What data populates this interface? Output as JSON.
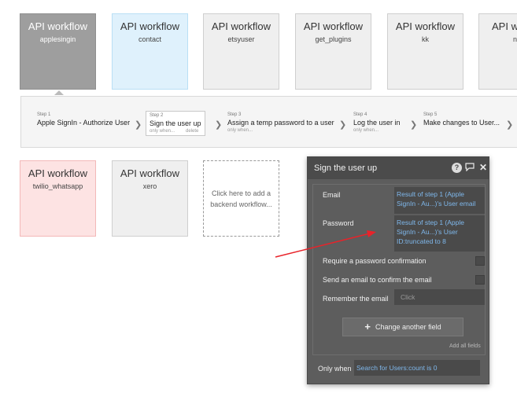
{
  "workflows_row1": [
    {
      "title": "API workflow",
      "subtitle": "applesingin",
      "state": "selected"
    },
    {
      "title": "API workflow",
      "subtitle": "contact",
      "state": "blue"
    },
    {
      "title": "API workflow",
      "subtitle": "etsyuser",
      "state": "default"
    },
    {
      "title": "API workflow",
      "subtitle": "get_plugins",
      "state": "default"
    },
    {
      "title": "API workflow",
      "subtitle": "kk",
      "state": "default"
    },
    {
      "title": "API workflow",
      "subtitle": "newt",
      "state": "default"
    }
  ],
  "workflows_row2": [
    {
      "title": "API workflow",
      "subtitle": "twilio_whatsapp",
      "state": "pink"
    },
    {
      "title": "API workflow",
      "subtitle": "xero",
      "state": "default"
    }
  ],
  "add_workflow_text": "Click here to add a backend workflow...",
  "steps": [
    {
      "num": "Step 1",
      "label": "Apple SignIn - Authorize User",
      "sub": ""
    },
    {
      "num": "Step 2",
      "label": "Sign the user up",
      "sub": "only when...",
      "delete": "delete"
    },
    {
      "num": "Step 3",
      "label": "Assign a temp password to a user",
      "sub": "only when..."
    },
    {
      "num": "Step 4",
      "label": "Log the user in",
      "sub": "only when..."
    },
    {
      "num": "Step 5",
      "label": "Make changes to User...",
      "sub": ""
    }
  ],
  "panel": {
    "title": "Sign the user up",
    "help_icon_glyph": "?",
    "email_label": "Email",
    "email_value": "Result of step 1 (Apple SignIn - Au...)'s User email",
    "password_label": "Password",
    "password_value": "Result of step 1 (Apple SignIn - Au...)'s User ID:truncated to 8",
    "require_confirm_label": "Require a password confirmation",
    "send_email_label": "Send an email to confirm the email",
    "remember_label": "Remember the email",
    "remember_placeholder": "Click",
    "change_field_label": "Change another field",
    "add_all_label": "Add all fields",
    "only_when_label": "Only when",
    "only_when_value": "Search for Users:count is 0"
  },
  "colors": {
    "accent_arrow": "#e8232a",
    "value_text": "#7fb8ec",
    "panel_bg": "#5d5d5d"
  }
}
